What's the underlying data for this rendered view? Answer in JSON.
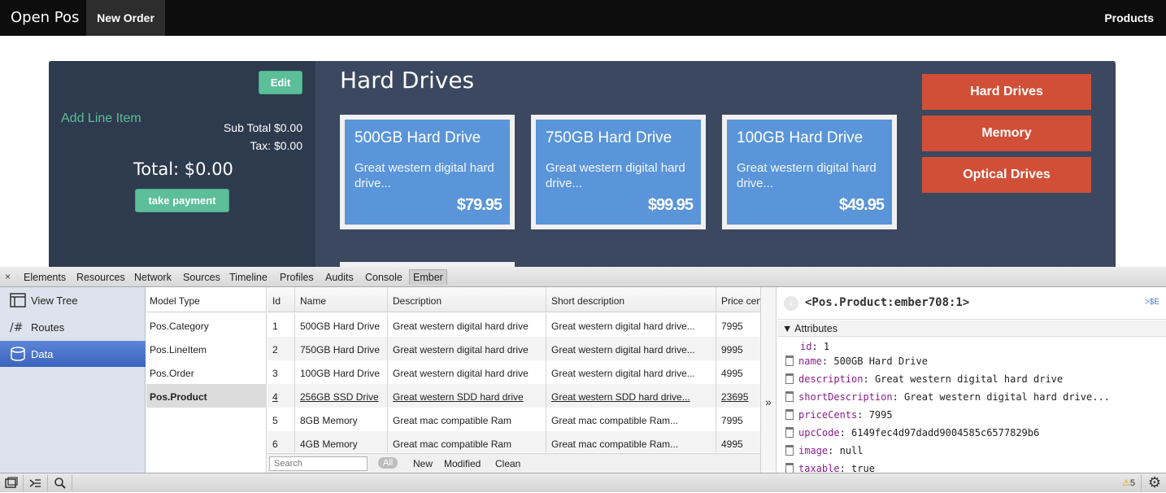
{
  "navbar": {
    "brand": "Open Pos",
    "new_order": "New Order",
    "products": "Products"
  },
  "order": {
    "edit": "Edit",
    "add_line_item": "Add Line Item",
    "subtotal": "Sub Total $0.00",
    "tax": "Tax: $0.00",
    "total": "Total: $0.00",
    "take_payment": "take payment"
  },
  "category": {
    "title": "Hard Drives",
    "products": [
      {
        "name": "500GB Hard Drive",
        "desc": "Great western digital hard drive...",
        "price": "$79.95"
      },
      {
        "name": "750GB Hard Drive",
        "desc": "Great western digital hard drive...",
        "price": "$99.95"
      },
      {
        "name": "100GB Hard Drive",
        "desc": "Great western digital hard drive...",
        "price": "$49.95"
      }
    ],
    "buttons": [
      "Hard Drives",
      "Memory",
      "Optical Drives"
    ]
  },
  "devtools": {
    "close": "×",
    "tabs": [
      "Elements",
      "Resources",
      "Network",
      "Sources",
      "Timeline",
      "Profiles",
      "Audits",
      "Console",
      "Ember"
    ],
    "sidebar": [
      "View Tree",
      "Routes",
      "Data"
    ],
    "model_header": "Model Type",
    "models": [
      "Pos.Category",
      "Pos.LineItem",
      "Pos.Order",
      "Pos.Product"
    ],
    "columns": [
      "Id",
      "Name",
      "Description",
      "Short description",
      "Price cents"
    ],
    "records": [
      [
        "1",
        "500GB Hard Drive",
        "Great western digital hard drive",
        "Great western digital hard drive...",
        "7995"
      ],
      [
        "2",
        "750GB Hard Drive",
        "Great western digital hard drive",
        "Great western digital hard drive...",
        "9995"
      ],
      [
        "3",
        "100GB Hard Drive",
        "Great western digital hard drive",
        "Great western digital hard drive...",
        "4995"
      ],
      [
        "4",
        "256GB SSD Drive",
        "Great western SDD hard drive",
        "Great western SDD hard drive...",
        "23695"
      ],
      [
        "5",
        "8GB Memory",
        "Great mac compatible Ram",
        "Great mac compatible Ram...",
        "7995"
      ],
      [
        "6",
        "4GB Memory",
        "Great mac compatible Ram",
        "Great mac compatible Ram...",
        "4995"
      ]
    ],
    "footer": {
      "search_placeholder": "Search",
      "all": "All",
      "new": "New",
      "modified": "Modified",
      "clean": "Clean"
    },
    "toggle": "»",
    "inspector": {
      "back": "‹",
      "title": "<Pos.Product:ember708:1>",
      "e_link": ">$E",
      "section": "▼ Attributes",
      "attrs": [
        {
          "k": "id",
          "v": "1"
        },
        {
          "k": "name",
          "v": "500GB Hard Drive"
        },
        {
          "k": "description",
          "v": "Great western digital hard drive"
        },
        {
          "k": "shortDescription",
          "v": "Great western digital hard drive..."
        },
        {
          "k": "priceCents",
          "v": "7995"
        },
        {
          "k": "upcCode",
          "v": "6149fec4d97dadd9004585c6577829b6"
        },
        {
          "k": "image",
          "v": "null"
        },
        {
          "k": "taxable",
          "v": "true"
        }
      ]
    },
    "warnings": "5"
  }
}
